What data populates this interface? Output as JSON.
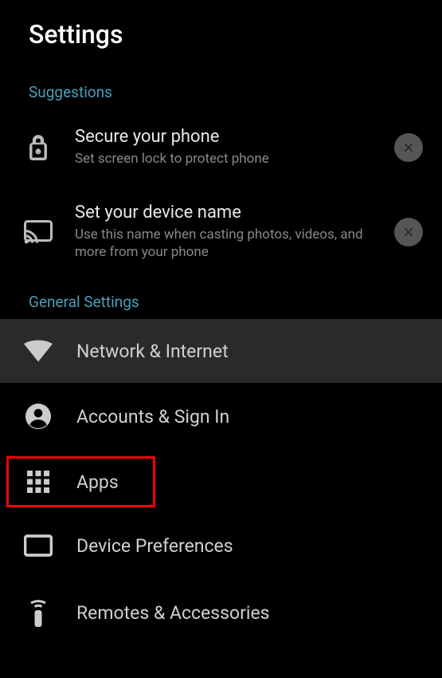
{
  "header": {
    "title": "Settings"
  },
  "suggestions": {
    "label": "Suggestions",
    "items": [
      {
        "title": "Secure your phone",
        "subtitle": "Set screen lock to protect phone"
      },
      {
        "title": "Set your device name",
        "subtitle": "Use this name when casting photos, videos, and more from your phone"
      }
    ]
  },
  "general": {
    "label": "General Settings",
    "items": [
      {
        "title": "Network & Internet"
      },
      {
        "title": "Accounts & Sign In"
      },
      {
        "title": "Apps"
      },
      {
        "title": "Device Preferences"
      },
      {
        "title": "Remotes & Accessories"
      }
    ]
  }
}
